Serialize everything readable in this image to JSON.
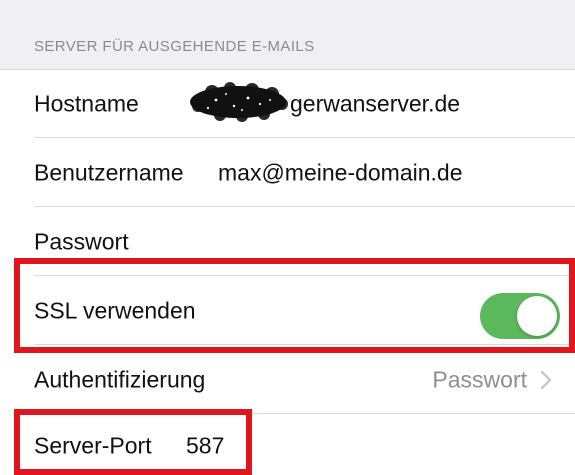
{
  "section": {
    "header": "SERVER FÜR AUSGEHENDE E-MAILS"
  },
  "rows": {
    "hostname": {
      "label": "Hostname",
      "value": "gerwanserver.de"
    },
    "username": {
      "label": "Benutzername",
      "value": "max@meine-domain.de"
    },
    "password": {
      "label": "Passwort"
    },
    "ssl": {
      "label": "SSL verwenden",
      "enabled": true
    },
    "auth": {
      "label": "Authentifizierung",
      "value": "Passwort"
    },
    "port": {
      "label": "Server-Port",
      "value": "587"
    }
  },
  "colors": {
    "toggle_on": "#5cb85c",
    "highlight": "#e0161e",
    "secondary_text": "#8e8e93",
    "background": "#efeff4"
  },
  "icons": {
    "auth_chevron": "chevron-right-icon",
    "redaction": "redaction-scribble"
  }
}
